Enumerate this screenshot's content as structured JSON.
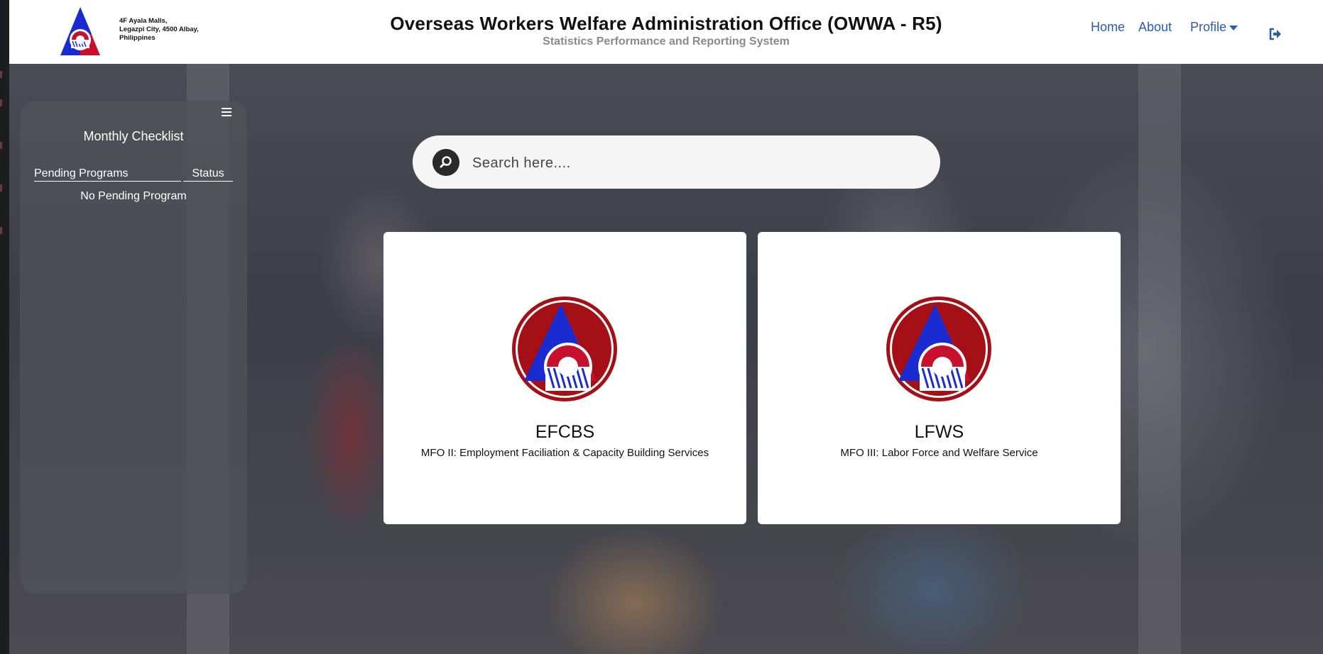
{
  "header": {
    "address_lines": [
      "4F Ayala Malls,",
      "Legazpi City, 4500 Albay,",
      "Philippines"
    ],
    "title": "Overseas Workers Welfare Administration Office (OWWA - R5)",
    "subtitle": "Statistics Performance and Reporting System",
    "nav": {
      "home": "Home",
      "about": "About",
      "profile": "Profile"
    }
  },
  "checklist": {
    "title": "Monthly Checklist",
    "col_programs": "Pending Programs",
    "col_status": "Status",
    "empty_text": "No Pending Program"
  },
  "search": {
    "placeholder": "Search here...."
  },
  "cards": [
    {
      "title": "EFCBS",
      "desc": "MFO II: Employment Faciliation & Capacity Building Services"
    },
    {
      "title": "LFWS",
      "desc": "MFO III: Labor Force and Welfare Service"
    }
  ],
  "colors": {
    "nav": "#2b5cab",
    "logo_red": "#c8102e",
    "logo_blue": "#1a2bd1"
  }
}
